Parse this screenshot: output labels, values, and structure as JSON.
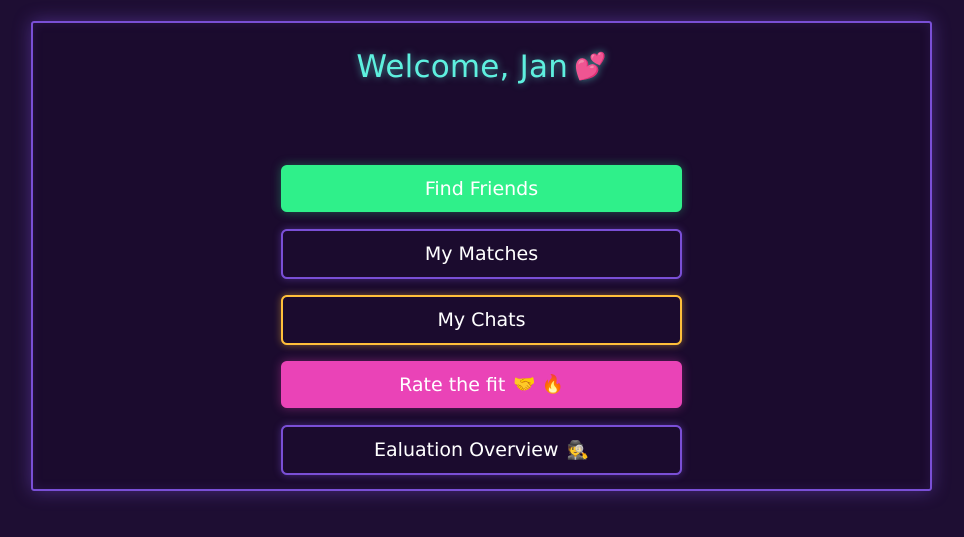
{
  "header": {
    "title": "Welcome, Jan",
    "title_emoji": "💕"
  },
  "menu": {
    "find_friends": "Find Friends",
    "my_matches": "My Matches",
    "my_chats": "My Chats",
    "rate_fit": "Rate the fit",
    "rate_fit_emojis": "🤝 🔥",
    "evaluation": "Ealuation Overview",
    "evaluation_emoji": "🕵"
  },
  "colors": {
    "background": "#1e0e33",
    "frame_border": "#7a4fd6",
    "title": "#5ef0df",
    "green_button": "#2ff08a",
    "gold_border": "#ffbf3a",
    "pink_button": "#ea43b7"
  }
}
